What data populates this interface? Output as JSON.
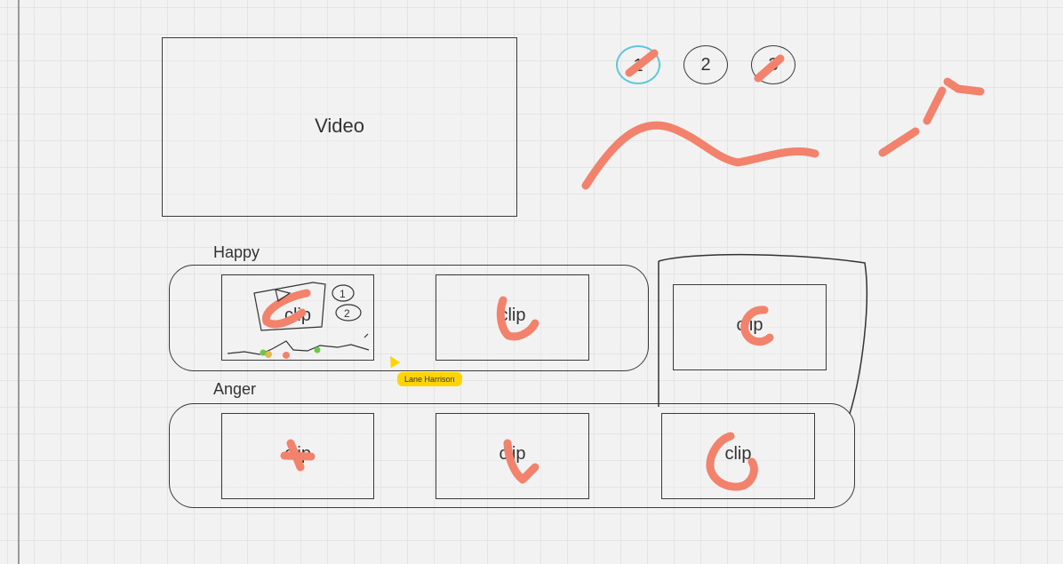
{
  "video": {
    "label": "Video"
  },
  "step_buttons": [
    "1",
    "2",
    "3"
  ],
  "rows": {
    "happy": {
      "label": "Happy",
      "clips": [
        "clip",
        "clip"
      ]
    },
    "loose_clip": "clip",
    "anger": {
      "label": "Anger",
      "clips": [
        "clip",
        "clip",
        "clip"
      ]
    }
  },
  "sketch": {
    "circle_one": "1",
    "circle_two": "2"
  },
  "collaborator": {
    "name": "Lane Harrison"
  },
  "colors": {
    "ink": "#333333",
    "highlight_stroke": "#f2826c",
    "cursor": "#ffd400",
    "selected_outline": "#5fc8d8"
  }
}
